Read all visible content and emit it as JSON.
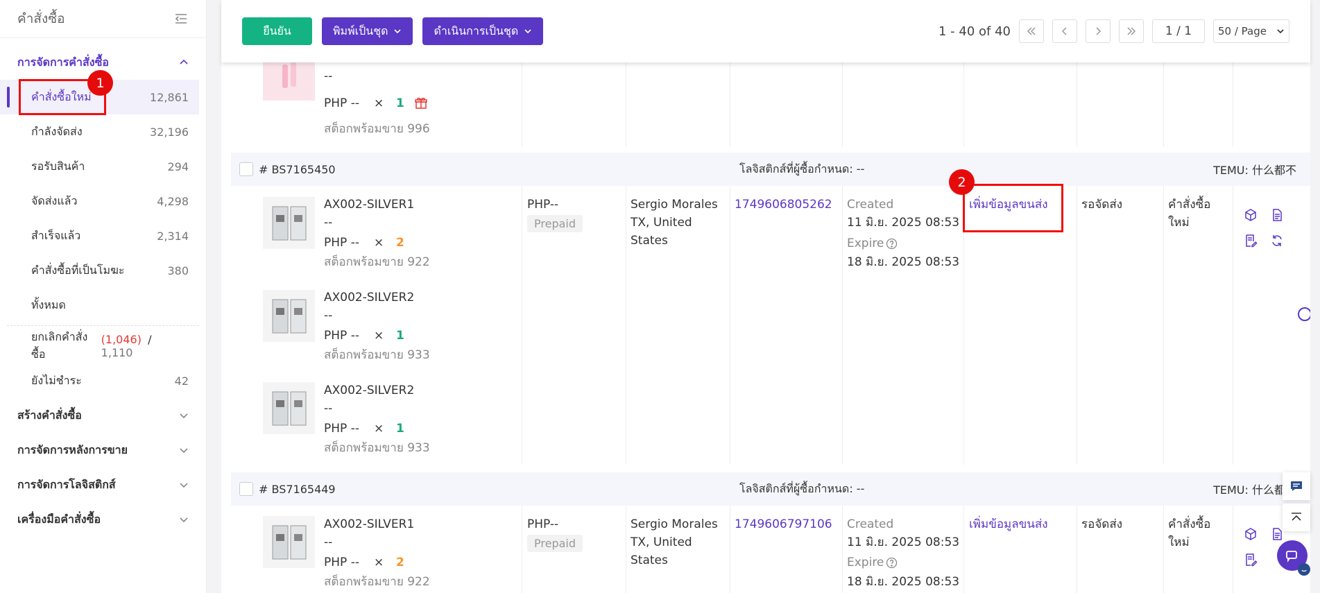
{
  "sidebar": {
    "title": "คำสั่งซื้อ",
    "group_active": "การจัดการคำสั่งซื้อ",
    "items": [
      {
        "label": "คำสั่งซื้อใหม่",
        "count": "12,861"
      },
      {
        "label": "กำลังจัดส่ง",
        "count": "32,196"
      },
      {
        "label": "รอรับสินค้า",
        "count": "294"
      },
      {
        "label": "จัดส่งแล้ว",
        "count": "4,298"
      },
      {
        "label": "สำเร็จแล้ว",
        "count": "2,314"
      },
      {
        "label": "คำสั่งซื้อที่เป็นโมฆะ",
        "count": "380"
      },
      {
        "label": "ทั้งหมด",
        "count": ""
      }
    ],
    "cancel": {
      "label": "ยกเลิกคำสั่งซื้อ",
      "red_count": "(1,046)",
      "sep": "/",
      "total": "1,110"
    },
    "unpaid": {
      "label": "ยังไม่ชำระ",
      "count": "42"
    },
    "groups": [
      "สร้างคำสั่งซื้อ",
      "การจัดการหลังการขาย",
      "การจัดการโลจิสติกส์",
      "เครื่องมือคำสั่งซื้อ"
    ]
  },
  "markers": [
    "1",
    "2"
  ],
  "toolbar": {
    "confirm": "ยืนยัน",
    "print_batch": "พิมพ์เป็นชุด",
    "operate_batch": "ดำเนินการเป็นชุด",
    "range": "1 - 40 of 40",
    "page": "1 / 1",
    "page_size": "50 / Page"
  },
  "top_partial": {
    "dash": "--",
    "price": "PHP --",
    "x": "×",
    "qty": "1",
    "stock": "สต็อกพร้อมขาย 996"
  },
  "orders": [
    {
      "id": "# BS7165450",
      "logistics": "โลจิสติกส์ที่ผู้ซื้อกำหนด: --",
      "shop": "TEMU: 什么都不",
      "payment": "PHP--",
      "payment_tag": "Prepaid",
      "buyer": [
        "Sergio Morales",
        "TX, United",
        "States"
      ],
      "tracking": "1749606805262",
      "created_label": "Created",
      "created": "11 มิ.ย. 2025 08:53",
      "expire_label": "Expire",
      "expire": "18 มิ.ย. 2025 08:53",
      "add_shipping": "เพิ่มข้อมูลขนส่ง",
      "status": "รอจัดส่ง",
      "order_type": [
        "คำสั่งซื้อ",
        "ใหม่"
      ],
      "products": [
        {
          "sku": "AX002-SILVER1",
          "dash": "--",
          "price": "PHP --",
          "x": "×",
          "qty": "2",
          "stock": "สต็อกพร้อมขาย 922"
        },
        {
          "sku": "AX002-SILVER2",
          "dash": "--",
          "price": "PHP --",
          "x": "×",
          "qty": "1",
          "stock": "สต็อกพร้อมขาย 933"
        },
        {
          "sku": "AX002-SILVER2",
          "dash": "--",
          "price": "PHP --",
          "x": "×",
          "qty": "1",
          "stock": "สต็อกพร้อมขาย 933"
        }
      ]
    },
    {
      "id": "# BS7165449",
      "logistics": "โลจิสติกส์ที่ผู้ซื้อกำหนด: --",
      "shop": "TEMU: 什么都不",
      "payment": "PHP--",
      "payment_tag": "Prepaid",
      "buyer": [
        "Sergio Morales",
        "TX, United",
        "States"
      ],
      "tracking": "1749606797106",
      "created_label": "Created",
      "created": "11 มิ.ย. 2025 08:53",
      "expire_label": "Expire",
      "expire": "18 มิ.ย. 2025 08:53",
      "add_shipping": "เพิ่มข้อมูลขนส่ง",
      "status": "รอจัดส่ง",
      "order_type": [
        "คำสั่งซื้อ",
        "ใหม่"
      ],
      "products": [
        {
          "sku": "AX002-SILVER1",
          "dash": "--",
          "price": "PHP --",
          "x": "×",
          "qty": "2",
          "stock": "สต็อกพร้อมขาย 922"
        }
      ]
    }
  ]
}
